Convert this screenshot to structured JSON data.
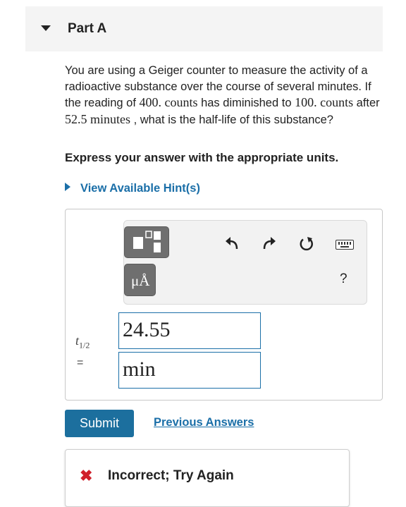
{
  "part": {
    "title": "Part A"
  },
  "question": {
    "text_1": "You are using a Geiger counter to measure the activity of a radioactive substance over the course of several minutes. If the reading of ",
    "reading_1": "400. counts",
    "text_2": " has diminished to ",
    "reading_2": "100. counts",
    "text_3": " after ",
    "time": "52.5 minutes",
    "text_4": " , what is the half-life of this substance?"
  },
  "instruction": "Express your answer with the appropriate units.",
  "hint": {
    "label": "View Available Hint(s)"
  },
  "toolbar": {
    "units_label": "μÅ",
    "help_label": "?",
    "icons": [
      "templates-icon",
      "units-icon",
      "undo-icon",
      "redo-icon",
      "reset-icon",
      "keyboard-icon",
      "help-icon"
    ]
  },
  "answer": {
    "variable": "t",
    "variable_sub": "1/2",
    "equals": "=",
    "value": "24.55",
    "unit": "min"
  },
  "actions": {
    "submit_label": "Submit",
    "previous_answers_label": "Previous Answers"
  },
  "feedback": {
    "icon": "✖",
    "message": "Incorrect; Try Again",
    "status_color": "#d01f2a"
  },
  "colors": {
    "accent": "#1b6fa8",
    "submit": "#1c6f9e",
    "header_bg": "#f4f4f4"
  }
}
